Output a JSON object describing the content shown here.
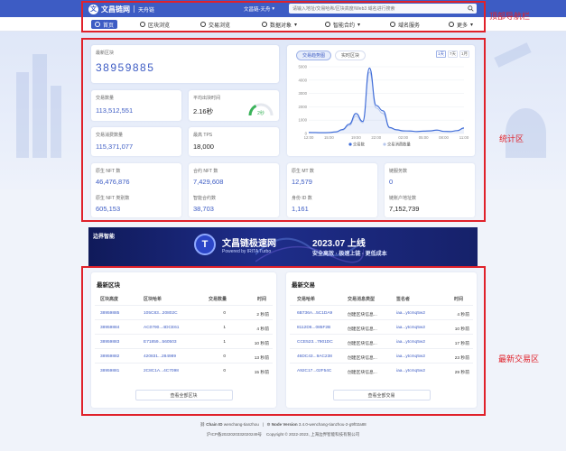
{
  "header": {
    "logo_glyph": "文",
    "logo_text": "文昌链网",
    "logo_sub": "天舟链",
    "chain_selector": "文昌链-天舟",
    "search_placeholder": "请输入地址/交易哈希/区块高度/Web3 域名进行搜索"
  },
  "nav": [
    {
      "label": "首页",
      "active": true
    },
    {
      "label": "区块浏览"
    },
    {
      "label": "交易浏览"
    },
    {
      "label": "数据对象"
    },
    {
      "label": "智能合约"
    },
    {
      "label": "域名服务"
    },
    {
      "label": "更多"
    }
  ],
  "stats": {
    "latest_block_label": "最新区块",
    "latest_block_value": "38959885",
    "tx_count_label": "交易数量",
    "tx_count_value": "113,512,551",
    "avg_time_label": "平均出块时间",
    "avg_time_value": "2.16秒",
    "gauge_value": "2秒",
    "gauge_level": 0.35,
    "tx_fee_label": "交易消费数量",
    "tx_fee_value": "115,371,077",
    "tps_label": "最高 TPS",
    "tps_value": "18,000",
    "native_nft_label": "原生 NFT 数",
    "native_nft_value": "46,476,876",
    "native_nft_class_label": "原生 NFT 类别数",
    "native_nft_class_value": "605,153",
    "contract_nft_label": "合约 NFT 数",
    "contract_nft_value": "7,429,608",
    "smart_contract_label": "智能合约数",
    "smart_contract_value": "38,703",
    "native_mt_label": "原生 MT 数",
    "native_mt_value": "12,579",
    "did_label": "身份 ID 数",
    "did_value": "1,161",
    "domain_label": "链服务数",
    "domain_value": "0",
    "account_label": "链账户地址数",
    "account_value": "7,152,739"
  },
  "chart_panel": {
    "tab_active": "交易趋势图",
    "tab_other": "实时区块",
    "ranges": [
      "1天",
      "7天",
      "1月"
    ],
    "legend_tx": "交易数",
    "legend_fee": "交易消费数量"
  },
  "chart_data": {
    "type": "line",
    "x": [
      "12:00",
      "13:00",
      "14:00",
      "15:00",
      "16:00",
      "17:00",
      "18:00",
      "19:00",
      "20:00",
      "21:00",
      "22:00",
      "23:00",
      "00:00",
      "01:00",
      "02:00",
      "03:00",
      "04:00",
      "05:00",
      "06:00",
      "07:00",
      "08:00",
      "09:00",
      "10:00",
      "11:00"
    ],
    "x_ticks": [
      "12:00",
      "15:00",
      "19:00",
      "22:00",
      "02:00",
      "05:00",
      "08:00",
      "11:00"
    ],
    "y_ticks": [
      "0",
      "1000",
      "2000",
      "3000",
      "4000",
      "5000"
    ],
    "ylim": [
      0,
      5000
    ],
    "series": [
      {
        "name": "交易数",
        "color": "#3d6bd8",
        "values": [
          80,
          70,
          60,
          70,
          120,
          300,
          700,
          1500,
          900,
          4900,
          2100,
          1700,
          450,
          280,
          200,
          190,
          150,
          180,
          200,
          260,
          160,
          150,
          220,
          420
        ]
      },
      {
        "name": "交易消费数量",
        "color": "#b8c8ee",
        "values": [
          60,
          60,
          50,
          60,
          100,
          250,
          600,
          1300,
          800,
          4600,
          1900,
          1500,
          400,
          250,
          180,
          170,
          140,
          160,
          180,
          240,
          150,
          140,
          200,
          380
        ]
      }
    ]
  },
  "banner": {
    "org": "边界智能",
    "title": "文昌链极速网",
    "powered": "Powered by IRITA Turbo",
    "date": "2023.07 上线",
    "slogan": "安全高效 · 极速上链 · 更低成本"
  },
  "blocks": {
    "title": "最新区块",
    "headers": [
      "区块高度",
      "区块哈希",
      "交易数量",
      "时间"
    ],
    "rows": [
      [
        "38959885",
        "105C83...20802C",
        "0",
        "2 秒前"
      ],
      [
        "38959884",
        "AC0790...4DCE61",
        "1",
        "4 秒前"
      ],
      [
        "38959883",
        "E71859...560503",
        "1",
        "10 秒前"
      ],
      [
        "38959882",
        "420831...284989",
        "0",
        "13 秒前"
      ],
      [
        "38959881",
        "2C8C1A...4C7098",
        "0",
        "15 秒前"
      ]
    ],
    "view_all": "查看全部区块"
  },
  "txs": {
    "title": "最新交易",
    "headers": [
      "交易哈希",
      "交易消息类型",
      "签名者",
      "时间"
    ],
    "rows": [
      [
        "6B736A...5C1DA9",
        "创建区块信息...",
        "iaa...ytcmq5w2",
        "4 秒前"
      ],
      [
        "8112D6...085F2B",
        "创建区块信息...",
        "iaa...ytcmq5w2",
        "10 秒前"
      ],
      [
        "CCE523...7901DC",
        "创建区块信息...",
        "iaa...ytcmq5w2",
        "17 秒前"
      ],
      [
        "46DC43...9AC238",
        "创建区块信息...",
        "iaa...ytcmq5w2",
        "23 秒前"
      ],
      [
        "A92C17...02F54C",
        "创建区块信息...",
        "iaa...ytcmq5w2",
        "29 秒前"
      ]
    ],
    "view_all": "查看全部交易"
  },
  "footer": {
    "chain_id_label": "Chain ID",
    "chain_id": "wenchang-tianzhou",
    "node_version_label": "Node Version",
    "node_version": "3.4.0-wenchang-tianzhou-2-g9f02a88",
    "icp": "沪ICP备2022020332020249号",
    "copyright": "Copyright © 2022-2023, 上海边界智能科技有限公司"
  },
  "annotations": {
    "top_nav": "顶部导航栏",
    "stats": "统计区",
    "latest": "最新交易区",
    "color": "#e0212a"
  }
}
